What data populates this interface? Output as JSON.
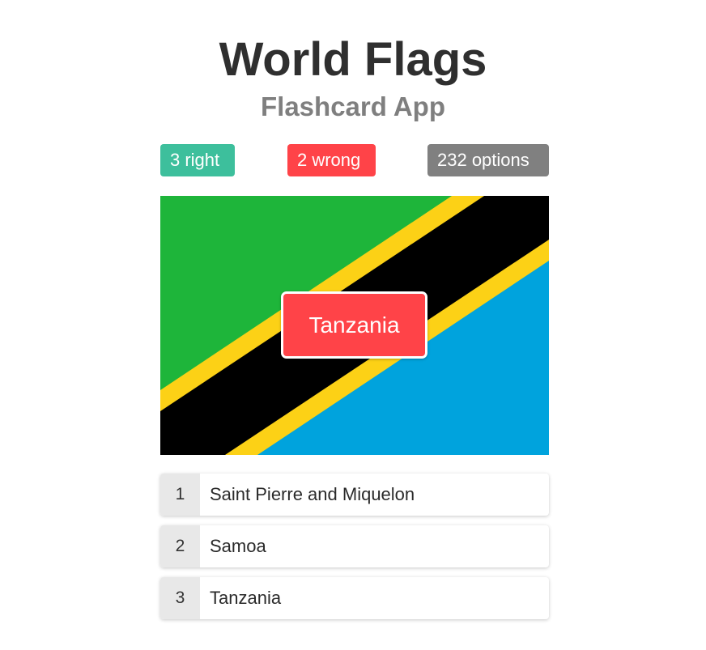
{
  "header": {
    "title": "World Flags",
    "subtitle": "Flashcard App"
  },
  "stats": {
    "right_label": "3 right",
    "wrong_label": "2 wrong",
    "options_label": "232 options"
  },
  "colors": {
    "right": "#3dbf9c",
    "wrong": "#ff4348",
    "options": "#808080",
    "flag_green": "#1eb53a",
    "flag_yellow": "#fcd116",
    "flag_black": "#000000",
    "flag_blue": "#00a3dd"
  },
  "card": {
    "flag_icon": "tanzania-flag",
    "answer_label": "Tanzania"
  },
  "options": [
    {
      "key": "1",
      "label": "Saint Pierre and Miquelon"
    },
    {
      "key": "2",
      "label": "Samoa"
    },
    {
      "key": "3",
      "label": "Tanzania"
    }
  ]
}
